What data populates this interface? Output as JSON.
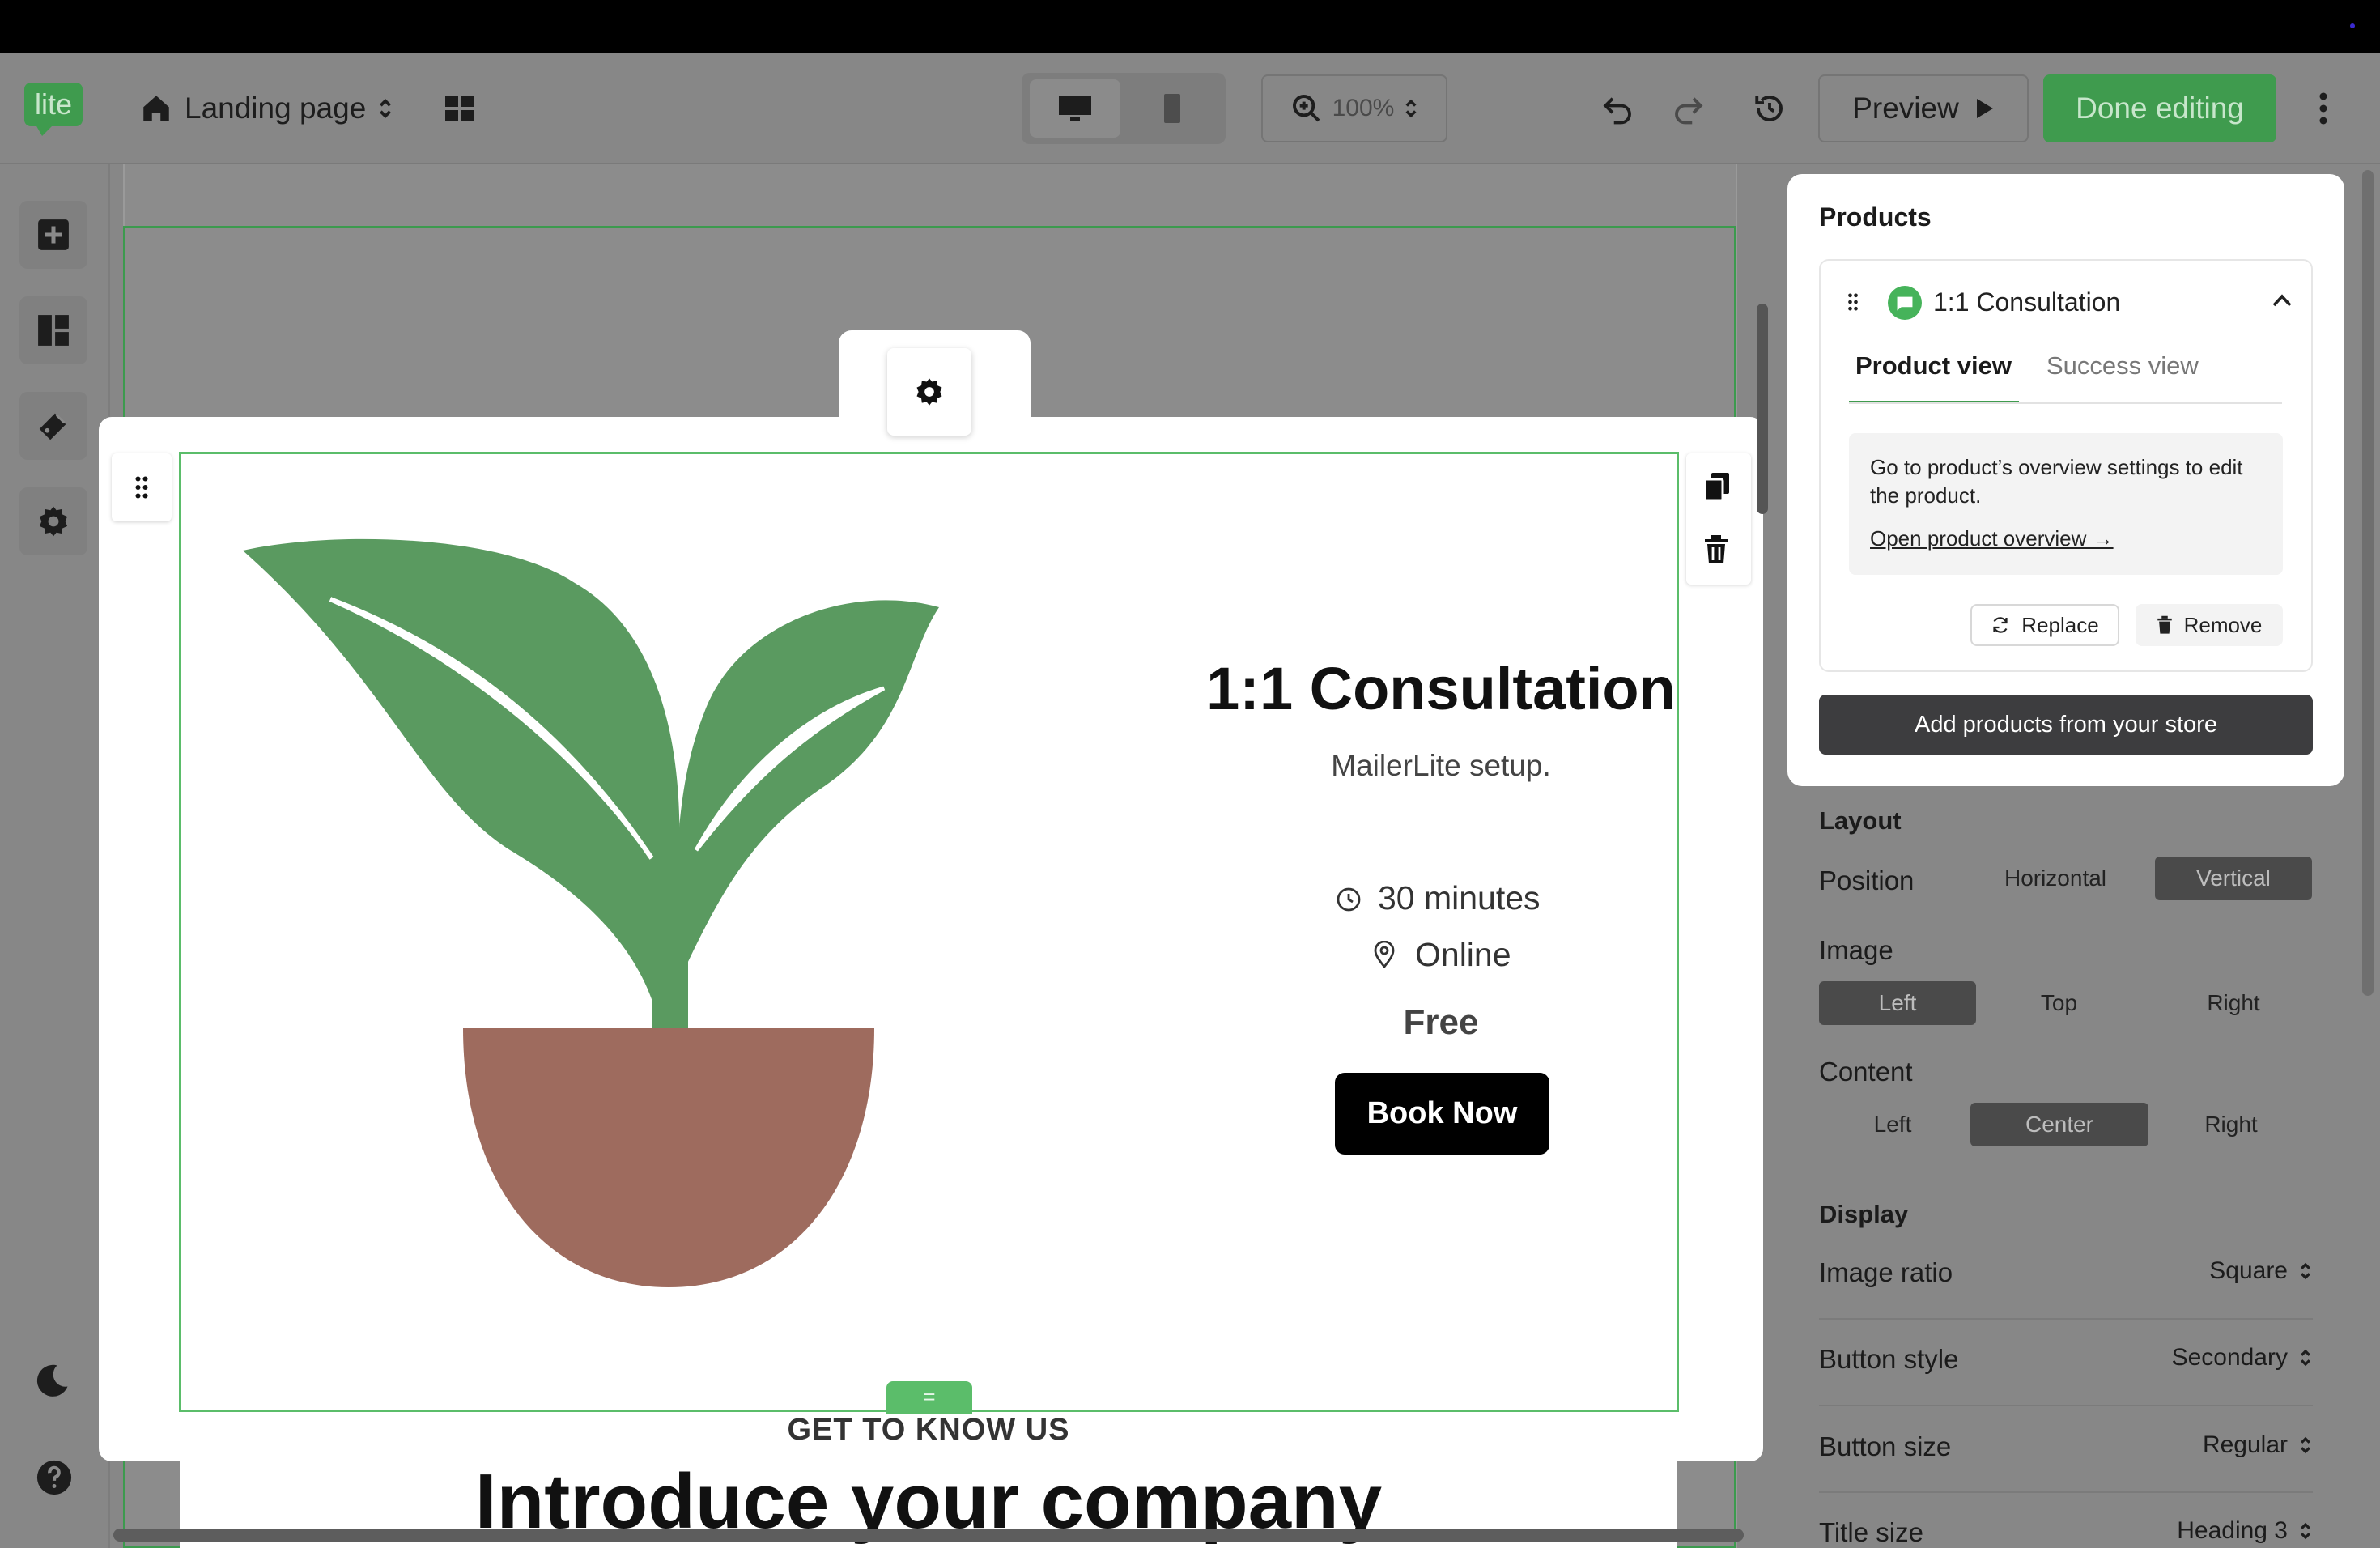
{
  "toolbar": {
    "logo_text": "lite",
    "page_name": "Landing page",
    "zoom": "100%",
    "preview_label": "Preview",
    "done_label": "Done editing"
  },
  "product": {
    "title": "1:1 Consultation",
    "subtitle": "MailerLite setup.",
    "duration": "30 minutes",
    "location": "Online",
    "price": "Free",
    "button": "Book Now"
  },
  "next_section": {
    "eyebrow": "GET TO KNOW US",
    "heading": "Introduce your company"
  },
  "products_panel": {
    "title": "Products",
    "item_name": "1:1 Consultation",
    "tabs": [
      "Product view",
      "Success view"
    ],
    "notice": "Go to product’s overview settings to edit the product.",
    "notice_link": "Open product overview →",
    "replace": "Replace",
    "remove": "Remove",
    "add_button": "Add products from your store"
  },
  "settings": {
    "layout_heading": "Layout",
    "position_label": "Position",
    "position_options": [
      "Horizontal",
      "Vertical"
    ],
    "image_label": "Image",
    "image_options": [
      "Left",
      "Top",
      "Right"
    ],
    "content_label": "Content",
    "content_options": [
      "Left",
      "Center",
      "Right"
    ],
    "display_heading": "Display",
    "image_ratio_label": "Image ratio",
    "image_ratio_value": "Square",
    "button_style_label": "Button style",
    "button_style_value": "Secondary",
    "button_size_label": "Button size",
    "button_size_value": "Regular",
    "title_size_label": "Title size",
    "title_size_value": "Heading 3"
  },
  "colors": {
    "accent_green": "#3f9b4e",
    "outline_green": "#5bbd6a",
    "leaf": "#5a9a60",
    "pot": "#9e6b5e"
  }
}
